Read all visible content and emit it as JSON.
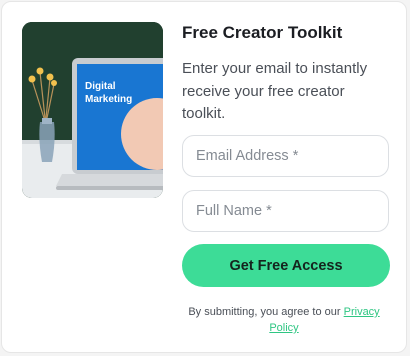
{
  "hero_image": {
    "screen_title_line1": "Digital",
    "screen_title_line2": "Marketing"
  },
  "form": {
    "title": "Free Creator Toolkit",
    "description": "Enter your email to instantly receive your free creator toolkit.",
    "email_placeholder": "Email Address *",
    "email_value": "",
    "name_placeholder": "Full Name *",
    "name_value": "",
    "submit_label": "Get Free Access",
    "disclaimer_prefix": "By submitting, you agree to our ",
    "privacy_link_label": "Privacy Policy"
  },
  "colors": {
    "accent_green": "#3ddc97",
    "link_green": "#2fc683",
    "wall_dark_green": "#1f3b2f",
    "screen_blue": "#1976d2"
  }
}
